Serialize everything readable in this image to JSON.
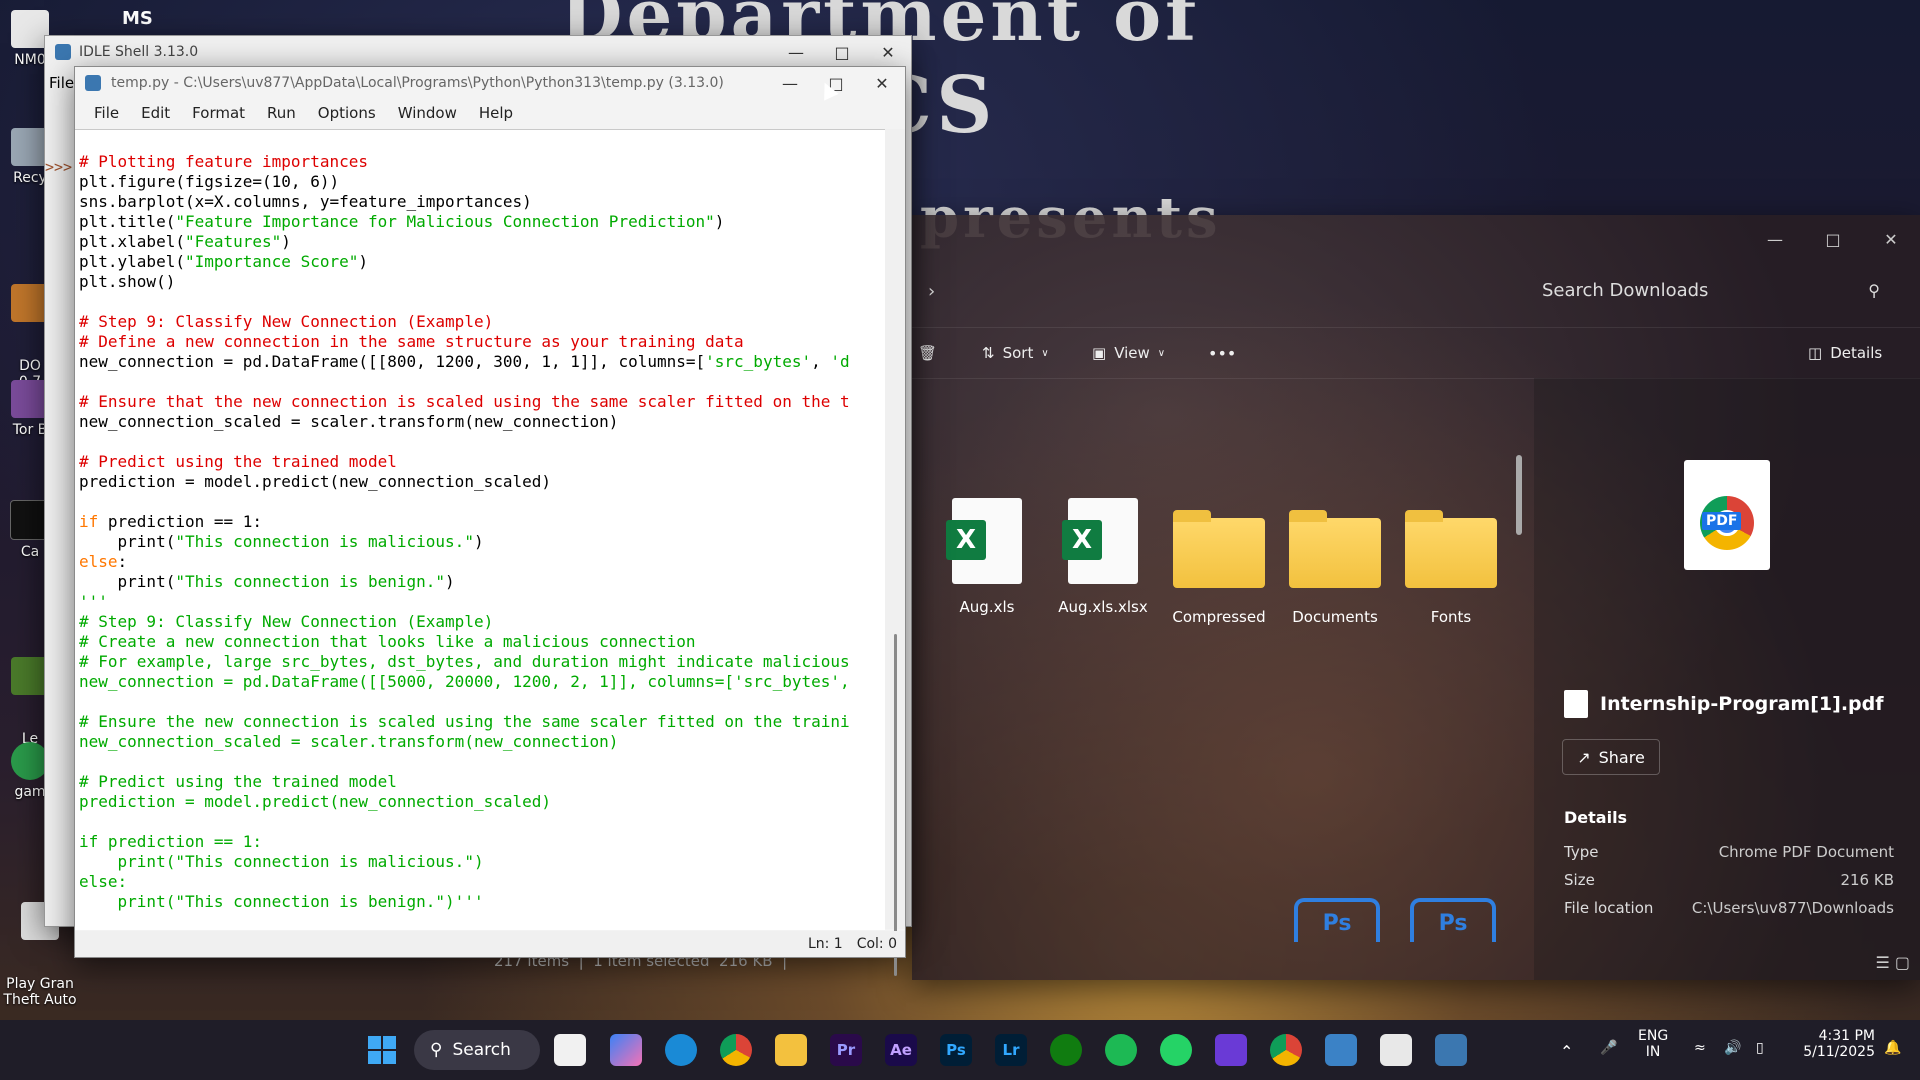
{
  "desktop": {
    "wallpaper_text_top": "Department of",
    "wallpaper_text_cs": "CS",
    "wallpaper_text_presents": "presents",
    "icons": [
      {
        "label": "NM0"
      },
      {
        "label": "Recy"
      },
      {
        "label": "DO\n0.7"
      },
      {
        "label": "Tor B"
      },
      {
        "label": "Ca"
      },
      {
        "label": "Le\nLau"
      },
      {
        "label": "gam"
      },
      {
        "label": "Play Gran\nTheft Auto"
      }
    ],
    "top_icon_text": "MS"
  },
  "shell_window": {
    "title": "IDLE Shell 3.13.0",
    "menu_fragment": "File",
    "prompt": ">>>"
  },
  "editor_window": {
    "title": "temp.py - C:\\Users\\uv877\\AppData\\Local\\Programs\\Python\\Python313\\temp.py (3.13.0)",
    "menu": [
      "File",
      "Edit",
      "Format",
      "Run",
      "Options",
      "Window",
      "Help"
    ],
    "status": {
      "line": "Ln: 1",
      "col": "Col: 0"
    },
    "code_lines": [
      [
        {
          "t": "# Plotting feature importances",
          "c": "com"
        }
      ],
      [
        {
          "t": "plt.figure(figsize=(10, 6))",
          "c": ""
        }
      ],
      [
        {
          "t": "sns.barplot(x=X.columns, y=feature_importances)",
          "c": ""
        }
      ],
      [
        {
          "t": "plt.title(",
          "c": ""
        },
        {
          "t": "\"Feature Importance for Malicious Connection Prediction\"",
          "c": "str"
        },
        {
          "t": ")",
          "c": ""
        }
      ],
      [
        {
          "t": "plt.xlabel(",
          "c": ""
        },
        {
          "t": "\"Features\"",
          "c": "str"
        },
        {
          "t": ")",
          "c": ""
        }
      ],
      [
        {
          "t": "plt.ylabel(",
          "c": ""
        },
        {
          "t": "\"Importance Score\"",
          "c": "str"
        },
        {
          "t": ")",
          "c": ""
        }
      ],
      [
        {
          "t": "plt.show()",
          "c": ""
        }
      ],
      [
        {
          "t": "",
          "c": ""
        }
      ],
      [
        {
          "t": "# Step 9: Classify New Connection (Example)",
          "c": "com"
        }
      ],
      [
        {
          "t": "# Define a new connection in the same structure as your training data",
          "c": "com"
        }
      ],
      [
        {
          "t": "new_connection = pd.DataFrame([[800, 1200, 300, 1, 1]], columns=[",
          "c": ""
        },
        {
          "t": "'src_bytes'",
          "c": "str"
        },
        {
          "t": ", ",
          "c": ""
        },
        {
          "t": "'d",
          "c": "str"
        }
      ],
      [
        {
          "t": "",
          "c": ""
        }
      ],
      [
        {
          "t": "# Ensure that the new connection is scaled using the same scaler fitted on the t",
          "c": "com"
        }
      ],
      [
        {
          "t": "new_connection_scaled = scaler.transform(new_connection)",
          "c": ""
        }
      ],
      [
        {
          "t": "",
          "c": ""
        }
      ],
      [
        {
          "t": "# Predict using the trained model",
          "c": "com"
        }
      ],
      [
        {
          "t": "prediction = model.predict(new_connection_scaled)",
          "c": ""
        }
      ],
      [
        {
          "t": "",
          "c": ""
        }
      ],
      [
        {
          "t": "if",
          "c": "kw"
        },
        {
          "t": " prediction == 1:",
          "c": ""
        }
      ],
      [
        {
          "t": "    print(",
          "c": ""
        },
        {
          "t": "\"This connection is malicious.\"",
          "c": "str"
        },
        {
          "t": ")",
          "c": ""
        }
      ],
      [
        {
          "t": "else",
          "c": "kw"
        },
        {
          "t": ":",
          "c": ""
        }
      ],
      [
        {
          "t": "    print(",
          "c": ""
        },
        {
          "t": "\"This connection is benign.\"",
          "c": "str"
        },
        {
          "t": ")",
          "c": ""
        }
      ],
      [
        {
          "t": "'''",
          "c": "str"
        }
      ],
      [
        {
          "t": "# Step 9: Classify New Connection (Example)",
          "c": "str"
        }
      ],
      [
        {
          "t": "# Create a new connection that looks like a malicious connection",
          "c": "str"
        }
      ],
      [
        {
          "t": "# For example, large src_bytes, dst_bytes, and duration might indicate malicious",
          "c": "str"
        }
      ],
      [
        {
          "t": "new_connection = pd.DataFrame([[5000, 20000, 1200, 2, 1]], columns=['src_bytes',",
          "c": "str"
        }
      ],
      [
        {
          "t": "",
          "c": ""
        }
      ],
      [
        {
          "t": "# Ensure the new connection is scaled using the same scaler fitted on the traini",
          "c": "str"
        }
      ],
      [
        {
          "t": "new_connection_scaled = scaler.transform(new_connection)",
          "c": "str"
        }
      ],
      [
        {
          "t": "",
          "c": ""
        }
      ],
      [
        {
          "t": "# Predict using the trained model",
          "c": "str"
        }
      ],
      [
        {
          "t": "prediction = model.predict(new_connection_scaled)",
          "c": "str"
        }
      ],
      [
        {
          "t": "",
          "c": ""
        }
      ],
      [
        {
          "t": "if prediction == 1:",
          "c": "str"
        }
      ],
      [
        {
          "t": "    print(\"This connection is malicious.\")",
          "c": "str"
        }
      ],
      [
        {
          "t": "else:",
          "c": "str"
        }
      ],
      [
        {
          "t": "    print(\"This connection is benign.\")'''",
          "c": "str"
        }
      ]
    ]
  },
  "explorer": {
    "search_placeholder": "Search Downloads",
    "toolbar": {
      "sort": "Sort",
      "view": "View",
      "more": "•••",
      "details": "Details"
    },
    "files": [
      {
        "name": "Aug.xls",
        "kind": "excel"
      },
      {
        "name": "Aug.xls.xlsx",
        "kind": "excel"
      },
      {
        "name": "Compressed",
        "kind": "folder"
      },
      {
        "name": "Documents",
        "kind": "folder"
      },
      {
        "name": "Fonts",
        "kind": "folder"
      }
    ],
    "selected_file": {
      "name": "Internship-Program[1].pdf",
      "share": "Share",
      "details_heading": "Details",
      "props": [
        {
          "key": "Type",
          "value": "Chrome PDF Document"
        },
        {
          "key": "Size",
          "value": "216 KB"
        },
        {
          "key": "File location",
          "value": "C:\\Users\\uv877\\Downloads"
        }
      ],
      "preview_tag": "PDF"
    },
    "status": "217 items  |  1 item selected  216 KB  |"
  },
  "taskbar": {
    "search_label": "Search",
    "apps": [
      "Pr",
      "Ae",
      "Ps",
      "Lr"
    ],
    "lang": "ENG",
    "region": "IN",
    "time": "4:31 PM",
    "date": "5/11/2025"
  },
  "colors": {
    "comment": "#dd0000",
    "keyword": "#ff7700",
    "string": "#00aa00",
    "taskbar": "#1f1d28"
  }
}
